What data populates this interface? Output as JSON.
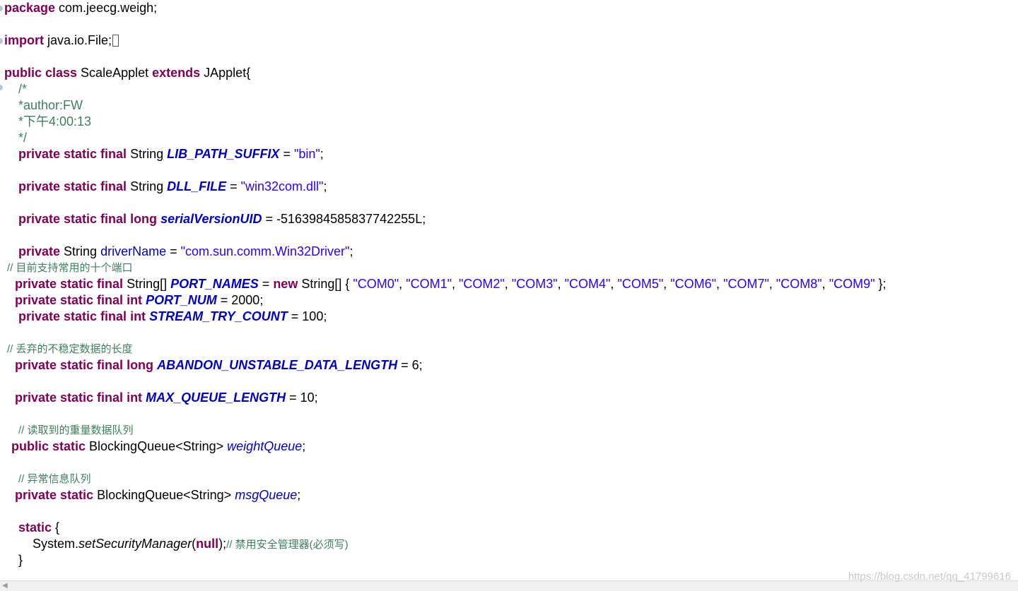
{
  "code": {
    "package_kw": "package",
    "package_name": " com.jeecg.weigh;",
    "import_kw": "import",
    "import_name": " java.io.File;",
    "class_kw": "public class",
    "class_name": " ScaleApplet ",
    "extends_kw": "extends",
    "extends_name": " JApplet{",
    "doc_open": "/*",
    "doc_author": "*author:FW",
    "doc_time": "*下午4:00:13",
    "doc_close": "*/",
    "psf": "private static final",
    "private_kw": "private",
    "string_type": " String ",
    "long_kw": " long",
    "int_kw": " int",
    "lib_path_name": "LIB_PATH_SUFFIX",
    "lib_path_value": "\"bin\"",
    "dll_name": "DLL_FILE",
    "dll_value": "\"win32com.dll\"",
    "serial_name": "serialVersionUID",
    "serial_value": " = -5163984585837742255L;",
    "driver_field": "driverName",
    "driver_value": "\"com.sun.comm.Win32Driver\"",
    "comment_ports": "// 目前支持常用的十个端口",
    "ports_type": " String[] ",
    "ports_name": "PORT_NAMES",
    "new_kw": "new",
    "ports_array_type": " String[] { ",
    "ports": [
      "\"COM0\"",
      "\"COM1\"",
      "\"COM2\"",
      "\"COM3\"",
      "\"COM4\"",
      "\"COM5\"",
      "\"COM6\"",
      "\"COM7\"",
      "\"COM8\"",
      "\"COM9\""
    ],
    "port_num_name": "PORT_NUM",
    "port_num_value": " = 2000;",
    "stream_name": "STREAM_TRY_COUNT",
    "stream_value": " = 100;",
    "comment_abandon": "// 丢弃的不稳定数据的长度",
    "abandon_name": "ABANDON_UNSTABLE_DATA_LENGTH",
    "abandon_value": " = 6;",
    "max_queue_name": "MAX_QUEUE_LENGTH",
    "max_queue_value": " = 10;",
    "comment_weight": "// 读取到的重量数据队列",
    "ps_public": "public static",
    "ps_private": "private static",
    "queue_type": " BlockingQueue<String> ",
    "weight_queue_name": "weightQueue",
    "comment_msg": "// 异常信息队列",
    "msg_queue_name": "msgQueue",
    "static_kw": "static",
    "static_open": " {",
    "system_call": "System.",
    "security_method": "setSecurityManager",
    "null_kw": "null",
    "comment_security": "// 禁用安全管理器(必须写)",
    "close_brace": "}"
  },
  "watermark": "https://blog.csdn.net/qq_41799616"
}
